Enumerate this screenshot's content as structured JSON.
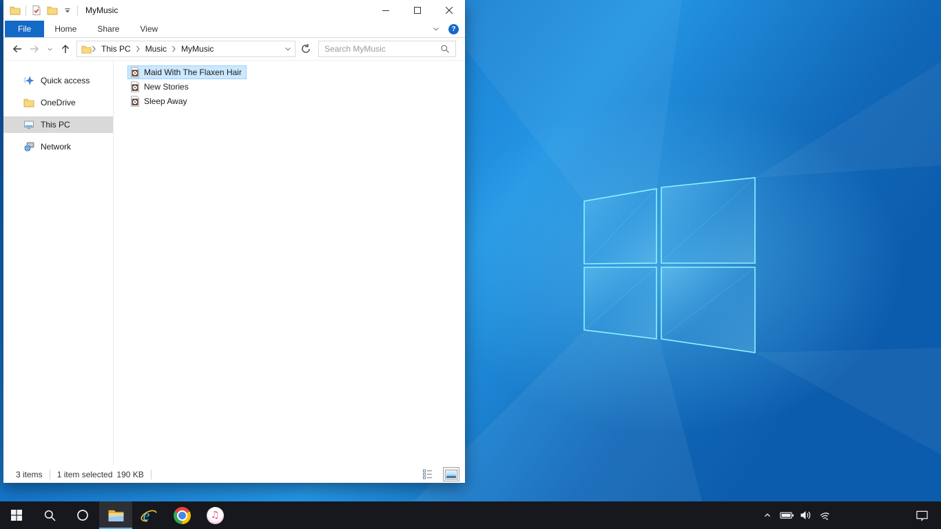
{
  "window": {
    "title": "MyMusic",
    "quick_access_toolbar": {
      "icons": [
        "explorer-window-icon",
        "properties-check-icon",
        "new-folder-icon",
        "customize-toolbar-chevron-icon"
      ]
    },
    "controls": [
      "minimize",
      "maximize",
      "close"
    ],
    "ribbon": {
      "tabs": [
        "File",
        "Home",
        "Share",
        "View"
      ],
      "active_tab": "File",
      "help_glyph": "?",
      "icons": [
        "expand-ribbon-chevron-icon",
        "help-icon"
      ]
    },
    "navigation": {
      "breadcrumb": [
        "This PC",
        "Music",
        "MyMusic"
      ],
      "search_placeholder": "Search MyMusic",
      "icons": [
        "back-icon",
        "forward-icon",
        "recent-locations-chevron-icon",
        "up-icon",
        "folder-icon",
        "address-dropdown-chevron-icon",
        "refresh-icon",
        "search-icon"
      ]
    },
    "sidebar": {
      "items": [
        {
          "label": "Quick access",
          "icon": "quick-access-star-icon",
          "selected": false
        },
        {
          "label": "OneDrive",
          "icon": "onedrive-folder-icon",
          "selected": false
        },
        {
          "label": "This PC",
          "icon": "this-pc-monitor-icon",
          "selected": true
        },
        {
          "label": "Network",
          "icon": "network-icon",
          "selected": false
        }
      ]
    },
    "files": [
      {
        "name": "Maid With The Flaxen Hair",
        "icon": "audio-file-icon",
        "selected": true
      },
      {
        "name": "New Stories",
        "icon": "audio-file-icon",
        "selected": false
      },
      {
        "name": "Sleep Away",
        "icon": "audio-file-icon",
        "selected": false
      }
    ],
    "statusbar": {
      "items_count": "3 items",
      "selection_count": "1 item selected",
      "selection_size": "190 KB",
      "view_toggles": [
        "details-view-icon",
        "large-icons-view-icon"
      ],
      "active_view": "large-icons-view"
    }
  },
  "taskbar": {
    "apps": [
      "start",
      "search",
      "cortana",
      "file-explorer",
      "internet-explorer",
      "chrome",
      "itunes"
    ],
    "active_app": "file-explorer",
    "tray": [
      "hidden-icons-chevron",
      "battery",
      "volume",
      "wifi",
      "action-center"
    ]
  },
  "colors": {
    "accent": "#1569c7",
    "selection-bg": "#cce8ff",
    "selection-border": "#99d1ff",
    "sidebar-selected": "#d9d9d9",
    "taskbar-bg": "#16181d",
    "taskbar-active": "#5fb2e8",
    "wallpaper-deep": "#0a4f9e",
    "wallpaper-mid": "#1575c8",
    "wallpaper-bright": "#2496e4",
    "logo-stroke": "#8df4ff",
    "folder-yellow": "#fbd978",
    "audio-icon-maroon": "#5a3a33"
  }
}
